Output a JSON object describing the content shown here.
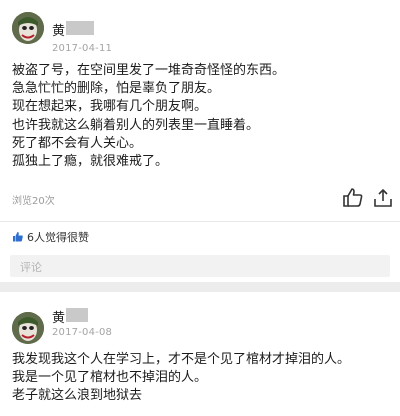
{
  "posts": [
    {
      "author": "黄",
      "date": "2017-04-11",
      "lines": [
        "被盗了号，在空间里发了一堆奇奇怪怪的东西。",
        "急急忙忙的删除，怕是辜负了朋友。",
        "现在想起来，我哪有几个朋友啊。",
        "也许我就这么躺着别人的列表里一直睡着。",
        "死了都不会有人关心。",
        "孤独上了瘾，就很难戒了。"
      ],
      "views": "浏览20次",
      "likes": "6人觉得很赞",
      "comment_placeholder": "评论"
    },
    {
      "author": "黄",
      "date": "2017-04-08",
      "lines": [
        "我发现我这个人在学习上，才不是个见了棺材才掉泪的人。",
        "我是一个见了棺材也不掉泪的人。",
        "老子就这么浪到地狱去"
      ]
    }
  ],
  "icons": {
    "like": "thumbs-up-icon",
    "share": "share-icon",
    "liked": "thumbs-up-filled-icon"
  },
  "colors": {
    "page_bg": "#eeeeee",
    "card_bg": "#ffffff",
    "meta_gray": "#a4a4a4",
    "like_blue": "#2f6fcf"
  }
}
